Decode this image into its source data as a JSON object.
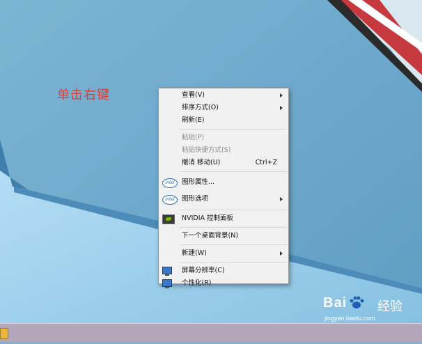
{
  "desktop": {
    "hint_text": "单击右键"
  },
  "context_menu": {
    "view": "查看(V)",
    "sort_by": "排序方式(O)",
    "refresh": "刷新(E)",
    "paste": "粘贴(P)",
    "paste_shortcut": "粘贴快捷方式(S)",
    "undo_move": "撤消 移动(U)",
    "undo_shortcut": "Ctrl+Z",
    "graphics_properties": "图形属性...",
    "graphics_options": "图形选项",
    "nvidia_control_panel": "NVIDIA 控制面板",
    "next_desktop_background": "下一个桌面背景(N)",
    "new": "新建(W)",
    "screen_resolution": "屏幕分辨率(C)",
    "personalize": "个性化(R)",
    "intel_icon_text": "intel"
  },
  "watermark": {
    "brand_left": "Bai",
    "brand_right": "经验",
    "url": "jingyan.baidu.com"
  },
  "colors": {
    "hint_text": "#d0413d",
    "desktop_bg": "#7fb3d1",
    "menu_bg": "#f1f1f1"
  }
}
